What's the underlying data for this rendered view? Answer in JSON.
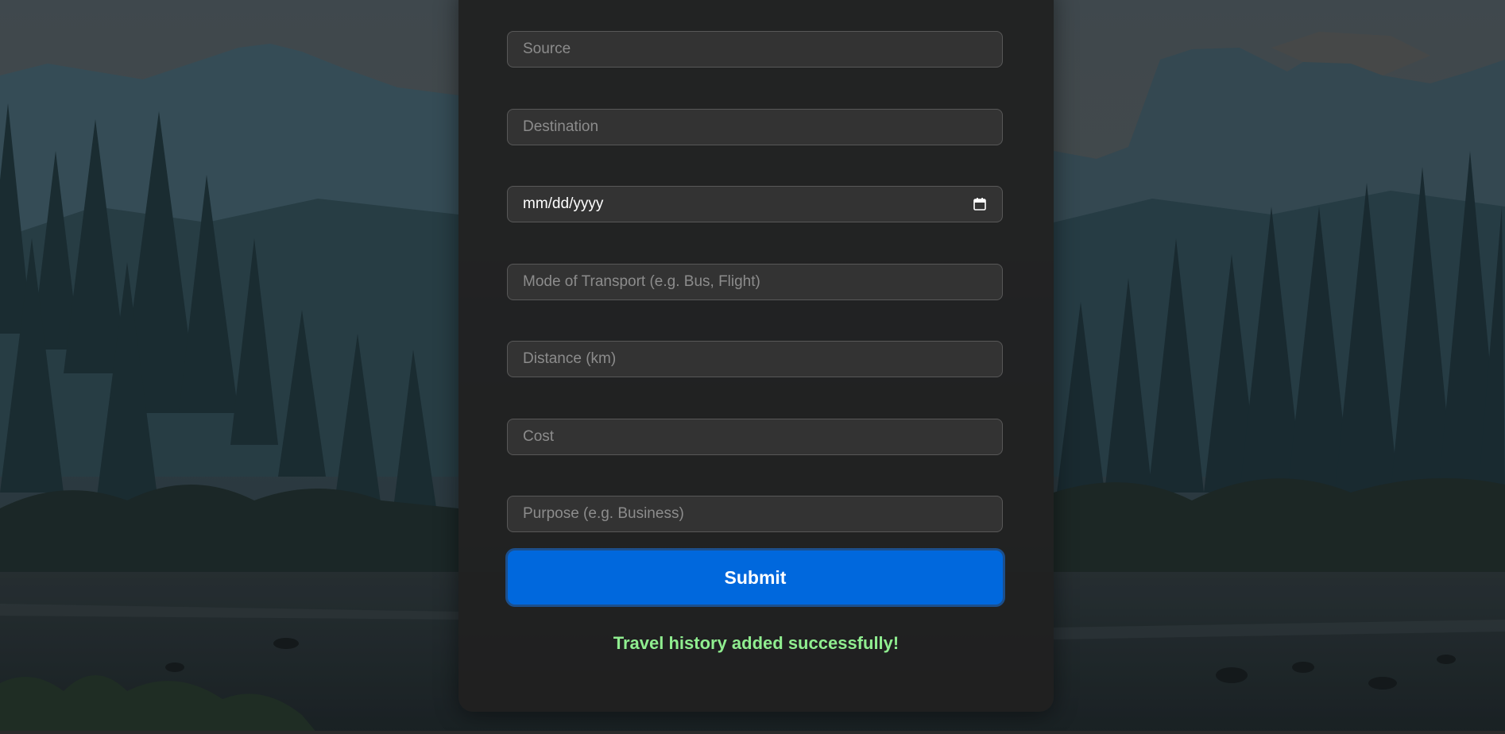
{
  "form": {
    "source_placeholder": "Source",
    "destination_placeholder": "Destination",
    "date_placeholder": "mm/dd/yyyy",
    "transport_placeholder": "Mode of Transport (e.g. Bus, Flight)",
    "distance_placeholder": "Distance (km)",
    "cost_placeholder": "Cost",
    "purpose_placeholder": "Purpose (e.g. Business)",
    "submit_label": "Submit",
    "status_message": "Travel history added successfully!"
  },
  "colors": {
    "card_bg": "#202020",
    "field_bg": "#333333",
    "field_border": "#585858",
    "submit_bg": "#0068dd",
    "success_text": "#90ee90"
  },
  "icons": {
    "date_picker": "calendar-icon"
  }
}
